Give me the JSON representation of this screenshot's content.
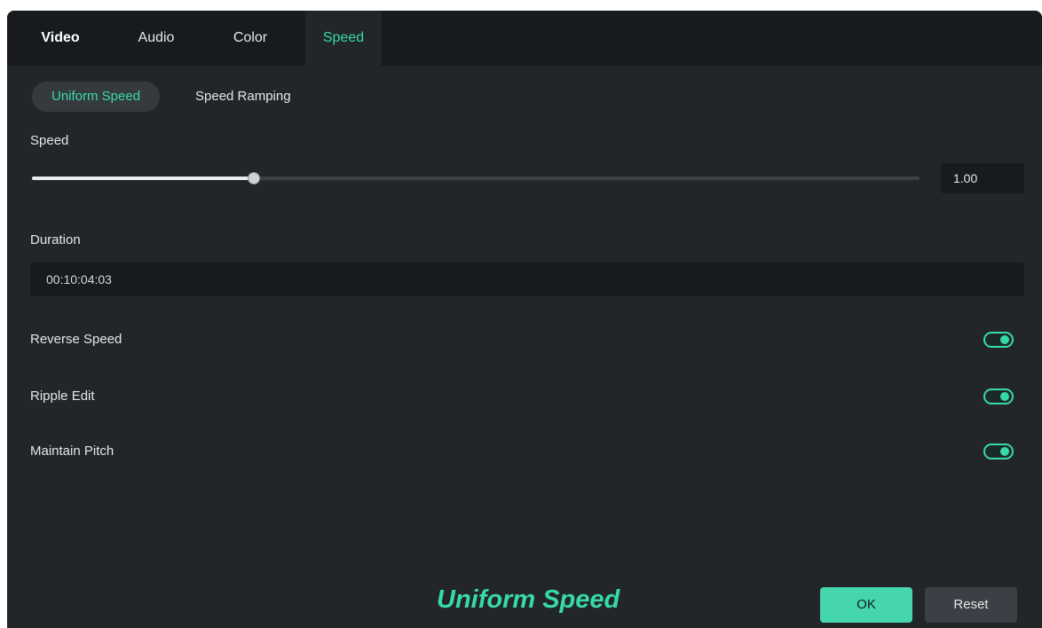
{
  "tabs": [
    {
      "label": "Video",
      "active": false
    },
    {
      "label": "Audio",
      "active": false
    },
    {
      "label": "Color",
      "active": false
    },
    {
      "label": "Speed",
      "active": true
    }
  ],
  "subtabs": [
    {
      "label": "Uniform Speed",
      "active": true
    },
    {
      "label": "Speed Ramping",
      "active": false
    }
  ],
  "speed": {
    "label": "Speed",
    "value": "1.00",
    "slider_level_percent": 25
  },
  "duration": {
    "label": "Duration",
    "value": "00:10:04:03"
  },
  "toggles": [
    {
      "label": "Reverse Speed",
      "on": true
    },
    {
      "label": "Ripple Edit",
      "on": true
    },
    {
      "label": "Maintain Pitch",
      "on": true
    }
  ],
  "overlay_caption": "Uniform Speed",
  "buttons": {
    "ok": "OK",
    "reset": "Reset"
  },
  "colors": {
    "accent": "#38d9a9",
    "background": "#222629",
    "tabbar": "#181b1e"
  }
}
